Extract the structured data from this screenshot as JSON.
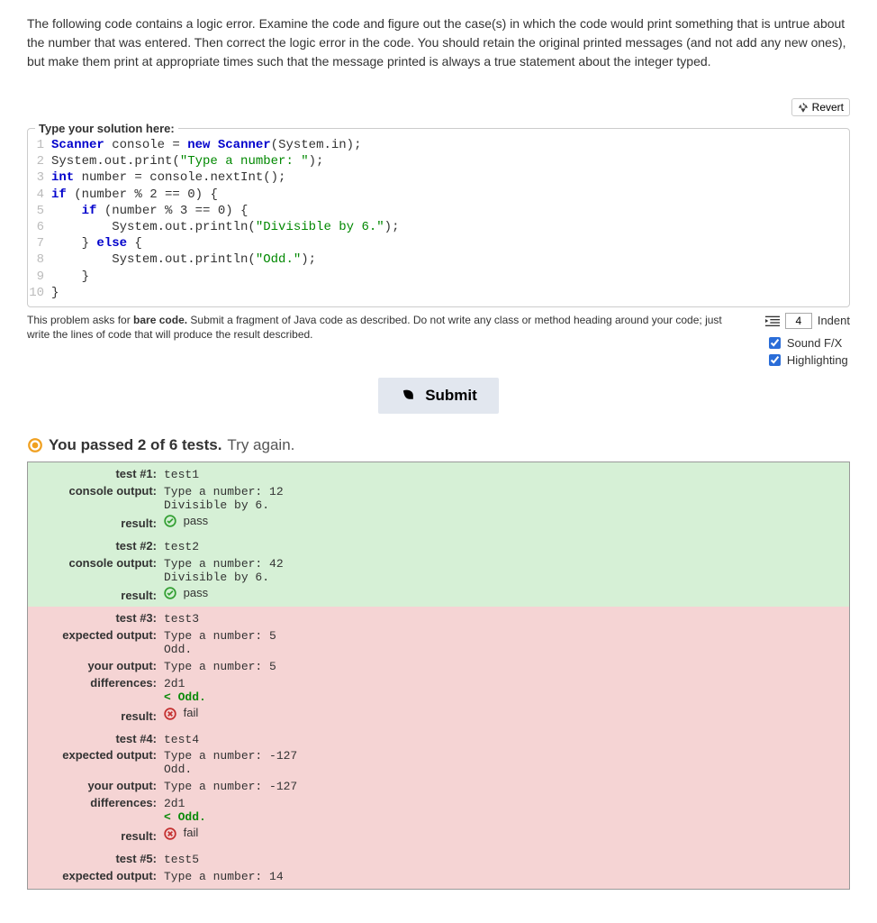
{
  "intro": "The following code contains a logic error. Examine the code and figure out the case(s) in which the code would print something that is untrue about the number that was entered. Then correct the logic error in the code. You should retain the original printed messages (and not add any new ones), but make them print at appropriate times such that the message printed is always a true statement about the integer typed.",
  "revert_label": "Revert",
  "editor_legend": "Type your solution here:",
  "code_lines": [
    [
      {
        "t": "Scanner",
        "c": "kw"
      },
      {
        "t": " console = "
      },
      {
        "t": "new",
        "c": "kw"
      },
      {
        "t": " "
      },
      {
        "t": "Scanner",
        "c": "kw"
      },
      {
        "t": "(System.in);"
      }
    ],
    [
      {
        "t": "System.out.print("
      },
      {
        "t": "\"Type a number: \"",
        "c": "str"
      },
      {
        "t": ");"
      }
    ],
    [
      {
        "t": "int",
        "c": "kw"
      },
      {
        "t": " number = console.nextInt();"
      }
    ],
    [
      {
        "t": "if",
        "c": "kw"
      },
      {
        "t": " (number % 2 == 0) {"
      }
    ],
    [
      {
        "t": "    "
      },
      {
        "t": "if",
        "c": "kw"
      },
      {
        "t": " (number % 3 == 0) {"
      }
    ],
    [
      {
        "t": "        System.out.println("
      },
      {
        "t": "\"Divisible by 6.\"",
        "c": "str"
      },
      {
        "t": ");"
      }
    ],
    [
      {
        "t": "    } "
      },
      {
        "t": "else",
        "c": "kw"
      },
      {
        "t": " {"
      }
    ],
    [
      {
        "t": "        System.out.println("
      },
      {
        "t": "\"Odd.\"",
        "c": "str"
      },
      {
        "t": ");"
      }
    ],
    [
      {
        "t": "    }"
      }
    ],
    [
      {
        "t": "}"
      }
    ]
  ],
  "hint_prefix": "This problem asks for ",
  "hint_bold": "bare code.",
  "hint_suffix": " Submit a fragment of Java code as described. Do not write any class or method heading around your code; just write the lines of code that will produce the result described.",
  "indent_label": "Indent",
  "indent_value": "4",
  "sound_label": "Sound F/X",
  "sound_checked": true,
  "highlight_label": "Highlighting",
  "highlight_checked": true,
  "submit_label": "Submit",
  "status_passed": "You passed 2 of 6 tests.",
  "status_try": "Try again.",
  "labels": {
    "test": "test #",
    "console_output": "console output:",
    "expected_output": "expected output:",
    "your_output": "your output:",
    "differences": "differences:",
    "result": "result:"
  },
  "result_pass": "pass",
  "result_fail": "fail",
  "tests": [
    {
      "num": "1",
      "name": "test1",
      "pass": true,
      "console_output": "Type a number: 12\nDivisible by 6."
    },
    {
      "num": "2",
      "name": "test2",
      "pass": true,
      "console_output": "Type a number: 42\nDivisible by 6."
    },
    {
      "num": "3",
      "name": "test3",
      "pass": false,
      "expected_output": "Type a number: 5\nOdd.",
      "your_output": "Type a number: 5",
      "differences": "2d1\n< Odd.",
      "diff_line2_class": "diff-add"
    },
    {
      "num": "4",
      "name": "test4",
      "pass": false,
      "expected_output": "Type a number: -127\nOdd.",
      "your_output": "Type a number: -127",
      "differences": "2d1\n< Odd.",
      "diff_line2_class": "diff-add"
    },
    {
      "num": "5",
      "name": "test5",
      "pass": false,
      "expected_output": "Type a number: 14"
    }
  ]
}
